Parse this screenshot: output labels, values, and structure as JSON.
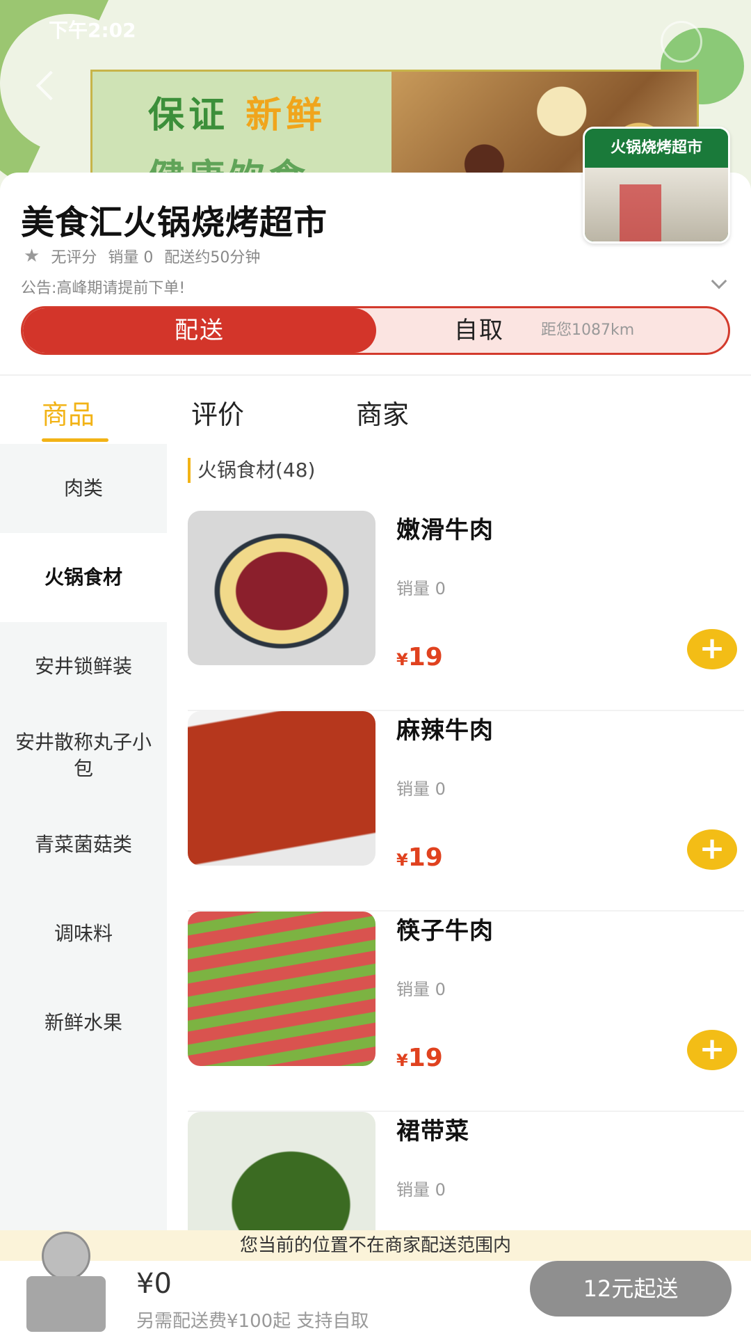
{
  "status_bar": {
    "time": "下午2:02"
  },
  "banner": {
    "line1_green": "保证",
    "line1_yellow": "新鲜",
    "line2": "健康饮食"
  },
  "store": {
    "name": "美食汇火锅烧烤超市",
    "thumb_sign": "火锅烧烤超市",
    "rating": "无评分",
    "sales": "销量 0",
    "delivery_time": "配送约50分钟",
    "notice": "公告:高峰期请提前下单!"
  },
  "mode": {
    "delivery": "配送",
    "pickup": "自取",
    "distance": "距您1087km"
  },
  "tabs": [
    {
      "label": "商品"
    },
    {
      "label": "评价"
    },
    {
      "label": "商家"
    }
  ],
  "categories": [
    {
      "label": "肉类"
    },
    {
      "label": "火锅食材"
    },
    {
      "label": "安井锁鲜装"
    },
    {
      "label": "安井散称丸子小包"
    },
    {
      "label": "青菜菌菇类"
    },
    {
      "label": "调味料"
    },
    {
      "label": "新鲜水果"
    }
  ],
  "section_title": "火锅食材(48)",
  "currency": "¥",
  "products": [
    {
      "name": "嫩滑牛肉",
      "sales": "销量 0",
      "price": "19"
    },
    {
      "name": "麻辣牛肉",
      "sales": "销量 0",
      "price": "19"
    },
    {
      "name": "筷子牛肉",
      "sales": "销量 0",
      "price": "19"
    },
    {
      "name": "裙带菜",
      "sales": "销量 0",
      "price": ""
    }
  ],
  "add_symbol": "+",
  "range_notice": "您当前的位置不在商家配送范围内",
  "cart": {
    "total": "¥0",
    "fee_note": "另需配送费¥100起  支持自取",
    "submit": "12元起送"
  },
  "colors": {
    "accent": "#f2b316",
    "delivery_red": "#d3352a",
    "price_red": "#e0421f"
  }
}
